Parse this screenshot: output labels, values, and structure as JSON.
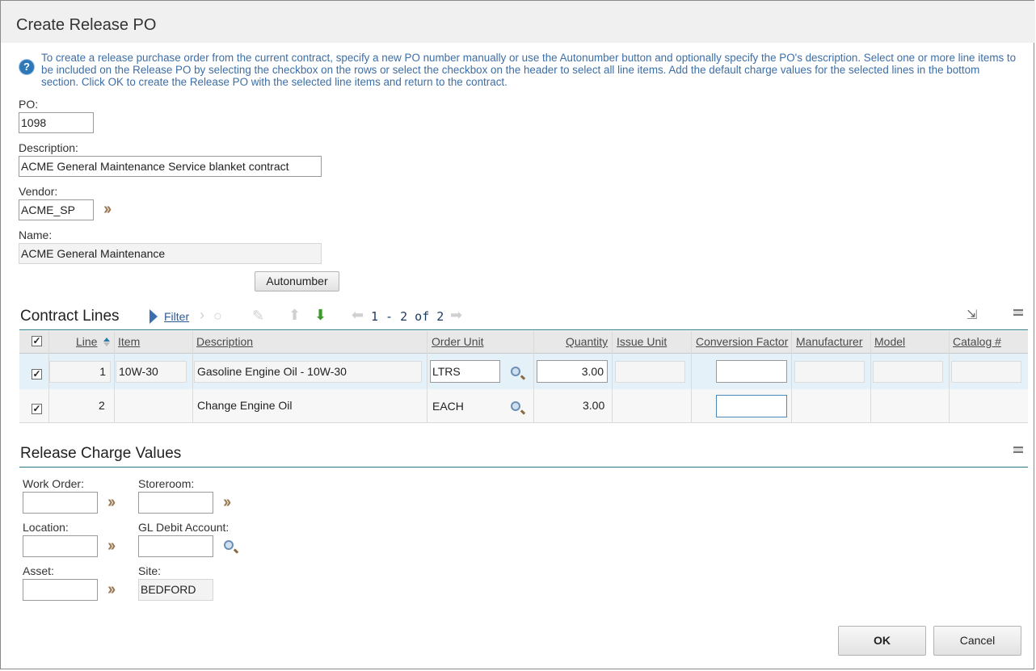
{
  "dialog": {
    "title": "Create Release PO",
    "help_text": "To create a release purchase order from the current contract, specify a new PO number manually or use the Autonumber button and optionally specify the PO's description. Select one or more line items to be included on the Release PO by selecting the checkbox on the rows or select the checkbox on the header to select all line items. Add the default charge values for the selected lines in the bottom section. Click OK to create the Release PO with the selected line items and return to the contract."
  },
  "form": {
    "po_label": "PO:",
    "po_value": "1098",
    "description_label": "Description:",
    "description_value": "ACME General Maintenance Service blanket contract",
    "vendor_label": "Vendor:",
    "vendor_value": "ACME_SP",
    "name_label": "Name:",
    "name_value": "ACME General Maintenance",
    "autonumber_label": "Autonumber"
  },
  "contract_lines": {
    "title": "Contract Lines",
    "filter_label": "Filter",
    "pager": "1 - 2 of 2",
    "columns": [
      "Line",
      "Item",
      "Description",
      "Order Unit",
      "Quantity",
      "Issue Unit",
      "Conversion Factor",
      "Manufacturer",
      "Model",
      "Catalog #"
    ],
    "rows": [
      {
        "checked": true,
        "line": "1",
        "item": "10W-30",
        "description": "Gasoline Engine Oil - 10W-30",
        "order_unit": "LTRS",
        "quantity": "3.00",
        "issue_unit": "",
        "conversion_factor": "",
        "manufacturer": "",
        "model": "",
        "catalog": ""
      },
      {
        "checked": true,
        "line": "2",
        "item": "",
        "description": "Change Engine Oil",
        "order_unit": "EACH",
        "quantity": "3.00",
        "issue_unit": "",
        "conversion_factor": "",
        "manufacturer": "",
        "model": "",
        "catalog": ""
      }
    ]
  },
  "charge_values": {
    "title": "Release Charge Values",
    "work_order_label": "Work Order:",
    "work_order_value": "",
    "storeroom_label": "Storeroom:",
    "storeroom_value": "",
    "location_label": "Location:",
    "location_value": "",
    "gl_debit_label": "GL Debit Account:",
    "gl_debit_value": "",
    "asset_label": "Asset:",
    "asset_value": "",
    "site_label": "Site:",
    "site_value": "BEDFORD"
  },
  "buttons": {
    "ok_label": "OK",
    "cancel_label": "Cancel"
  },
  "icons": {
    "help": "help-circle-icon",
    "detail_menu": "double-chevron-icon",
    "lookup": "magnifier-icon",
    "filter": "filter-triangle-icon",
    "download": "download-icon",
    "minimize": "minimize-icon"
  },
  "colors": {
    "help_text": "#3d6ea6",
    "section_underline": "#2a7a8a",
    "selected_row": "#e5f1f8"
  }
}
